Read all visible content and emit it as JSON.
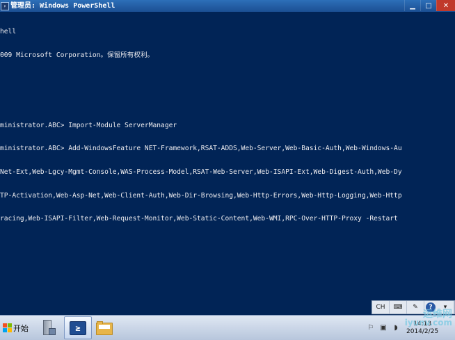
{
  "window": {
    "title": "管理员: Windows PowerShell"
  },
  "console": {
    "lines": [
      "hell",
      "009 Microsoft Corporation。保留所有权利。",
      "",
      "",
      "ministrator.ABC> Import-Module ServerManager",
      "ministrator.ABC> Add-WindowsFeature NET-Framework,RSAT-ADDS,Web-Server,Web-Basic-Auth,Web-Windows-Au",
      "Net-Ext,Web-Lgcy-Mgmt-Console,WAS-Process-Model,RSAT-Web-Server,Web-ISAPI-Ext,Web-Digest-Auth,Web-Dy",
      "TP-Activation,Web-Asp-Net,Web-Client-Auth,Web-Dir-Browsing,Web-Http-Errors,Web-Http-Logging,Web-Http",
      "racing,Web-ISAPI-Filter,Web-Request-Monitor,Web-Static-Content,Web-WMI,RPC-Over-HTTP-Proxy -Restart"
    ]
  },
  "langbar": {
    "lang": "CH",
    "help": "?"
  },
  "taskbar": {
    "start_label": "开始",
    "powershell_label": "≥",
    "clock_time": "14:13",
    "clock_date": "2014/2/25"
  },
  "watermark": {
    "cn": "运维网",
    "en": "iyunv.com"
  },
  "colors": {
    "console_bg": "#012456",
    "console_fg": "#eeedf0"
  }
}
